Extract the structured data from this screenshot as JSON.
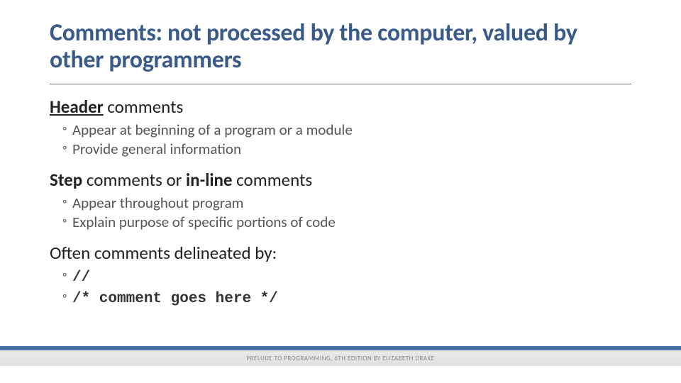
{
  "title": "Comments: not processed by the computer, valued by other programmers",
  "section1": {
    "head_bold_under": "Header",
    "head_rest": " comments",
    "bullets": [
      "Appear at beginning of a program or a module",
      "Provide general information"
    ]
  },
  "section2": {
    "head_b1": "Step",
    "head_txt1": " comments or ",
    "head_b2": "in-line",
    "head_txt2": " comments",
    "bullets": [
      "Appear throughout program",
      "Explain purpose of specific portions of code"
    ]
  },
  "section3": {
    "head": "Often comments delineated by:",
    "code1": "//",
    "code2": "/* comment goes here */"
  },
  "footer": "PRELUDE TO PROGRAMMING, 6TH EDITION BY ELIZABETH DRAKE"
}
